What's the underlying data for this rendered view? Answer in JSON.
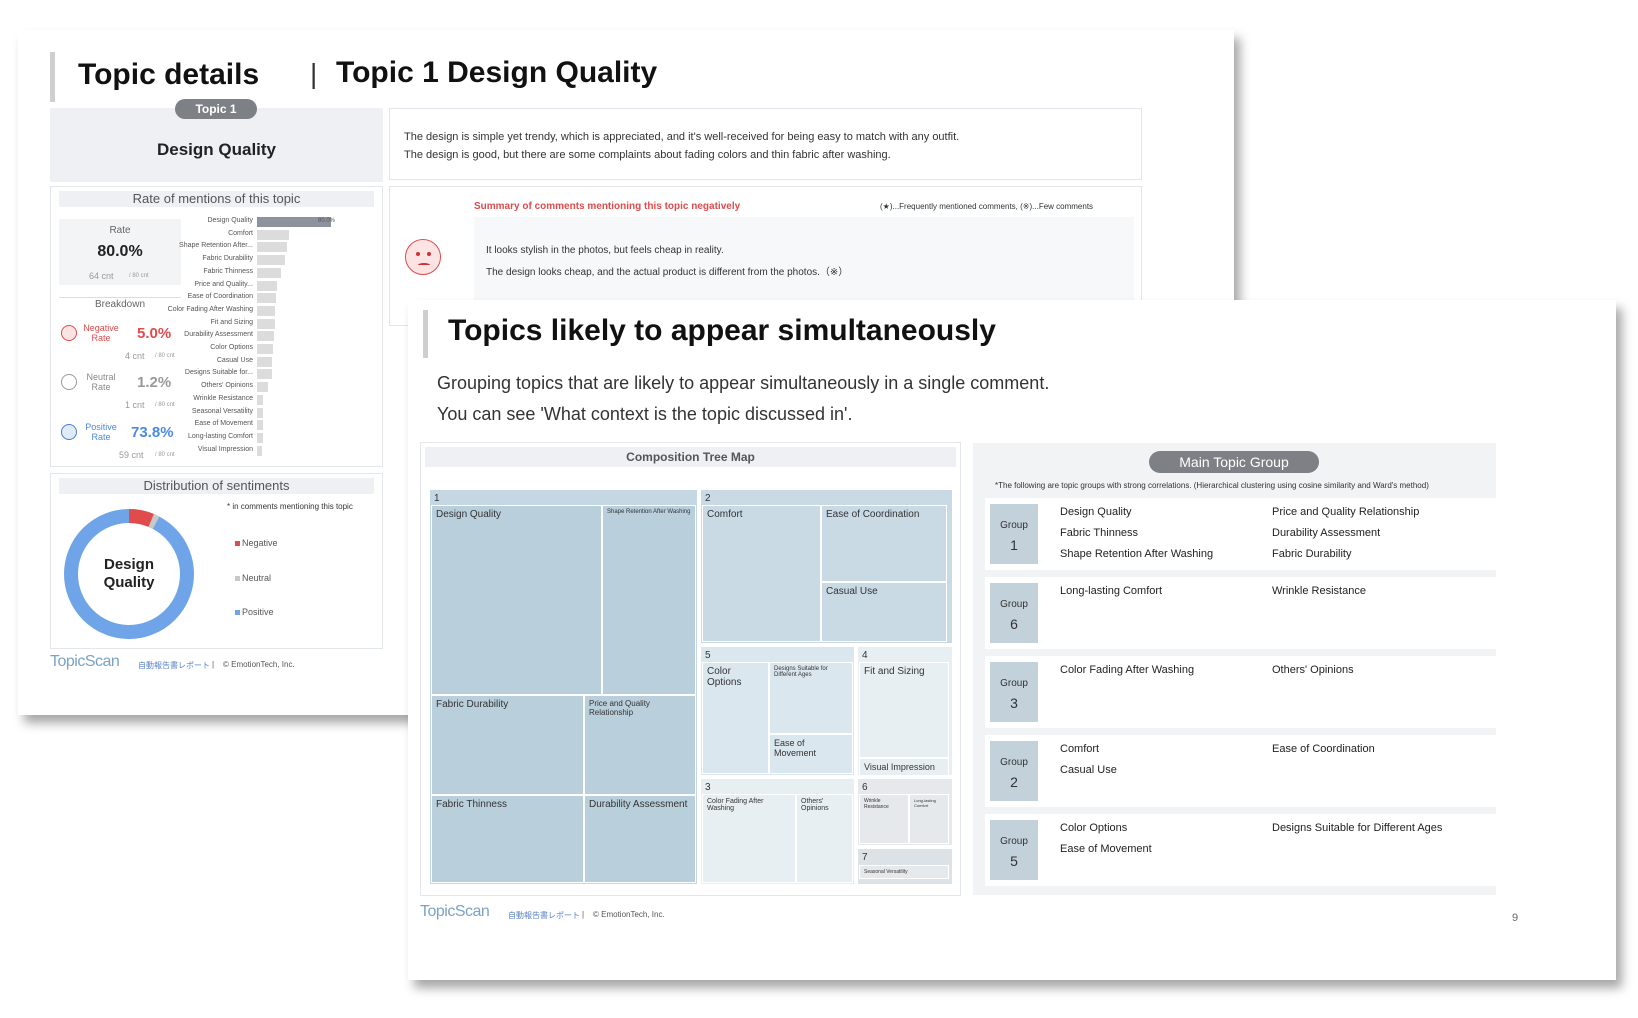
{
  "back_slide": {
    "title": "Topic details",
    "subtitle": "Topic 1 Design Quality",
    "topic_pill": "Topic 1",
    "topic_name": "Design Quality",
    "description": [
      "The design is simple yet trendy, which is appreciated, and it's well-received for being easy to match with any outfit.",
      "The design is good, but there are some complaints about fading colors and thin fabric after washing."
    ],
    "rate_section": {
      "header": "Rate of mentions of this topic",
      "rate_label": "Rate",
      "rate_value": "80.0%",
      "rate_cnt": "64 cnt",
      "rate_total": "/ 80 cnt",
      "breakdown_label": "Breakdown",
      "negative": {
        "label": "Negative Rate",
        "value": "5.0%",
        "cnt": "4 cnt",
        "total": "/ 80 cnt"
      },
      "neutral": {
        "label": "Neutral Rate",
        "value": "1.2%",
        "cnt": "1 cnt",
        "total": "/ 80 cnt"
      },
      "positive": {
        "label": "Positive Rate",
        "value": "73.8%",
        "cnt": "59 cnt",
        "total": "/ 80 cnt"
      }
    },
    "mention_bars": [
      {
        "label": "Design Quality",
        "value": 80.0,
        "value_label": "80.0%"
      },
      {
        "label": "Comfort",
        "value": 35
      },
      {
        "label": "Shape Retention After...",
        "value": 32
      },
      {
        "label": "Fabric Durability",
        "value": 30
      },
      {
        "label": "Fabric Thinness",
        "value": 26
      },
      {
        "label": "Price and Quality...",
        "value": 22
      },
      {
        "label": "Ease of Coordination",
        "value": 20
      },
      {
        "label": "Color Fading After Washing",
        "value": 19
      },
      {
        "label": "Fit and Sizing",
        "value": 19
      },
      {
        "label": "Durability Assessment",
        "value": 18
      },
      {
        "label": "Color Options",
        "value": 17
      },
      {
        "label": "Casual Use",
        "value": 16
      },
      {
        "label": "Designs Suitable for...",
        "value": 16
      },
      {
        "label": "Others' Opinions",
        "value": 12
      },
      {
        "label": "Wrinkle Resistance",
        "value": 7
      },
      {
        "label": "Seasonal Versatility",
        "value": 6
      },
      {
        "label": "Ease of Movement",
        "value": 6
      },
      {
        "label": "Long-lasting Comfort",
        "value": 6
      },
      {
        "label": "Visual Impression",
        "value": 5
      }
    ],
    "negative_summary": {
      "header": "Summary of comments mentioning this topic negatively",
      "legend": "(★)...Frequently mentioned comments, (※)...Few comments",
      "lines": [
        "It looks stylish in the photos, but feels cheap in reality.",
        "The design looks cheap, and the actual product is different from the photos.（※）"
      ]
    },
    "sentiment_section": {
      "header": "Distribution of sentiments",
      "note": "* in comments mentioning this topic",
      "center_label": "Design Quality",
      "legend": [
        "Negative",
        "Neutral",
        "Positive"
      ],
      "values": {
        "negative": 5.0,
        "neutral": 1.2,
        "positive": 73.8
      }
    },
    "footer": {
      "logo": "TopicScan",
      "jp": "自動報告書レポート",
      "sep": "|",
      "copyright": "© EmotionTech, Inc."
    }
  },
  "front_slide": {
    "title": "Topics likely to appear simultaneously",
    "desc1": "Grouping topics that are likely to appear simultaneously in a single comment.",
    "desc2": "You can see 'What context is the topic discussed in'.",
    "treemap": {
      "header": "Composition Tree Map",
      "cells": {
        "g1": "1",
        "design_quality": "Design Quality",
        "shape_retention": "Shape Retention After Washing",
        "fabric_durability": "Fabric Durability",
        "price_quality": "Price and Quality Relationship",
        "fabric_thinness": "Fabric Thinness",
        "durability_assessment": "Durability Assessment",
        "g2": "2",
        "comfort": "Comfort",
        "ease_coordination": "Ease of Coordination",
        "casual_use": "Casual Use",
        "g5": "5",
        "color_options": "Color Options",
        "designs_ages": "Designs Suitable for Different Ages",
        "ease_movement": "Ease of Movement",
        "g4": "4",
        "fit_sizing": "Fit and Sizing",
        "visual_impression": "Visual Impression",
        "g3": "3",
        "color_fading": "Color Fading After Washing",
        "others_opinions": "Others' Opinions",
        "g6": "6",
        "wrinkle": "Wrinkle Resistance",
        "long_comfort": "Long-lasting Comfort",
        "g7": "7",
        "seasonal": "Seasonal Versatility"
      }
    },
    "groups": {
      "header": "Main Topic Group",
      "note": "*The following are topic groups with strong correlations. (Hierarchical clustering using cosine similarity and Ward's method)",
      "group_word": "Group",
      "rows": [
        {
          "num": "1",
          "left": [
            "Design Quality",
            "Fabric Thinness",
            "Shape Retention After Washing"
          ],
          "right": [
            "Price and Quality Relationship",
            "Durability Assessment",
            "Fabric Durability"
          ]
        },
        {
          "num": "6",
          "left": [
            "Long-lasting Comfort"
          ],
          "right": [
            "Wrinkle Resistance"
          ]
        },
        {
          "num": "3",
          "left": [
            "Color Fading After Washing"
          ],
          "right": [
            "Others' Opinions"
          ]
        },
        {
          "num": "2",
          "left": [
            "Comfort",
            "Casual Use"
          ],
          "right": [
            "Ease of Coordination"
          ]
        },
        {
          "num": "5",
          "left": [
            "Color Options",
            "Ease of Movement"
          ],
          "right": [
            "Designs Suitable for Different Ages"
          ]
        }
      ]
    },
    "footer": {
      "logo": "TopicScan",
      "jp": "自動報告書レポート",
      "sep": "|",
      "copyright": "© EmotionTech, Inc."
    },
    "page_number": "9"
  },
  "colors": {
    "negative": "#e04b4b",
    "neutral": "#c8c8c8",
    "positive": "#6fa4e8",
    "treemap": "#b9cfdc",
    "pill": "#7d8085"
  }
}
